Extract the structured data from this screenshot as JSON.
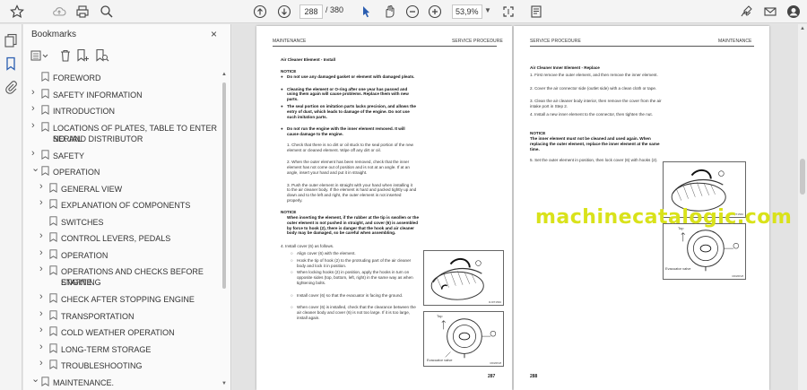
{
  "toolbar": {
    "page_current": "288",
    "page_total": "/ 380",
    "zoom": "53,9%",
    "icons": [
      "star-icon",
      "cloud-upload-icon",
      "print-icon",
      "search-icon",
      "prev-page-icon",
      "next-page-icon",
      "select-cursor-icon",
      "hand-tool-icon",
      "zoom-out-icon",
      "zoom-in-icon",
      "fit-page-icon",
      "page-display-icon",
      "sign-icon",
      "email-icon",
      "account-icon"
    ]
  },
  "rail": {
    "icons": [
      "pages-icon",
      "bookmarks-icon",
      "attachments-icon"
    ]
  },
  "bookmarks_panel": {
    "title": "Bookmarks",
    "close": "×",
    "items": [
      {
        "label": "FOREWORD",
        "level": 0,
        "expand": "none"
      },
      {
        "label": "SAFETY INFORMATION",
        "level": 0,
        "expand": "collapsed"
      },
      {
        "label": "INTRODUCTION",
        "level": 0,
        "expand": "collapsed"
      },
      {
        "label": "LOCATIONS OF PLATES, TABLE TO ENTER SERIAL",
        "label2": "NO. AND DISTRIBUTOR",
        "level": 0,
        "expand": "collapsed"
      },
      {
        "label": "SAFETY",
        "level": 0,
        "expand": "collapsed"
      },
      {
        "label": "OPERATION",
        "level": 0,
        "expand": "expanded"
      },
      {
        "label": "GENERAL VIEW",
        "level": 1,
        "expand": "collapsed"
      },
      {
        "label": "EXPLANATION OF COMPONENTS",
        "level": 1,
        "expand": "collapsed"
      },
      {
        "label": "SWITCHES",
        "level": 1,
        "expand": "none"
      },
      {
        "label": "CONTROL LEVERS, PEDALS",
        "level": 1,
        "expand": "collapsed"
      },
      {
        "label": "OPERATION",
        "level": 1,
        "expand": "collapsed"
      },
      {
        "label": "OPERATIONS AND CHECKS BEFORE STARTING",
        "label2": "ENGINE",
        "level": 1,
        "expand": "collapsed"
      },
      {
        "label": "CHECK AFTER STOPPING ENGINE",
        "level": 1,
        "expand": "collapsed"
      },
      {
        "label": "TRANSPORTATION",
        "level": 1,
        "expand": "collapsed"
      },
      {
        "label": "COLD WEATHER OPERATION",
        "level": 1,
        "expand": "collapsed"
      },
      {
        "label": "LONG-TERM STORAGE",
        "level": 1,
        "expand": "collapsed"
      },
      {
        "label": "TROUBLESHOOTING",
        "level": 1,
        "expand": "collapsed"
      },
      {
        "label": "MAINTENANCE.",
        "level": 0,
        "expand": "expanded"
      }
    ]
  },
  "document": {
    "left_page": {
      "header_left": "MAINTENANCE",
      "header_right": "SERVICE PROCEDURE",
      "section_title": "Air Cleaner Element - Install",
      "notice": "NOTICE",
      "bullets": [
        "Do not use any damaged gasket or element with damaged pleats.",
        "Cleaning the element or O-ring after one year has passed and using them again will cause problems. Replace them with new parts.",
        "The seal portion on imitation parts lacks precision, and allows the entry of dust, which leads to damage of the engine. Do not use such imitation parts.",
        "Do not run the engine with the inner element removed. It will cause damage to the engine."
      ],
      "steps": [
        "1. Check that there is no dirt or oil stuck to the seal portion of the new element or cleaned element. Wipe off any dirt or oil.",
        "2. When the outer element has been removed, check that the inner element has not come out of position and is not at an angle. If at an angle, insert your hand and put it in straight.",
        "3. Push the outer element in straight with your hand when installing it to the air cleaner body. If the element is hard and packed tightly up and down and to the left and right, the outer element is not inserted properly."
      ],
      "notice2": "NOTICE",
      "notice2_text": "When inserting the element, if the rubber at the tip is swollen or the outer element is not pushed in straight, and cover (6) is assembled by force to hook (2), there is danger that the hook and air cleaner body may be damaged, so be careful when assembling.",
      "step4": "4. Install cover (6) as follows.",
      "step4_items": [
        "Align cover (6) with the element.",
        "Hook the tip of hook (2) to the protruding part of the air cleaner body and lock it in position.",
        "When locking hooks (2) in position, apply the hooks in turn on opposite sides (top, bottom, left, right) in the same way as when tightening bolts.",
        "Install cover (6) so that the evacuator is facing the ground.",
        "When cover (6) is installed, check that the clearance between the air cleaner body and cover (6) is not too large. If it is too large, install again."
      ],
      "fig1_caption": "RJ0T1560",
      "fig2_top": "Top",
      "fig2_callout": "Evacuator valve",
      "fig2_caption": "RDW0V8",
      "page_number": "287"
    },
    "right_page": {
      "header_left": "SERVICE PROCEDURE",
      "header_right": "MAINTENANCE",
      "section_title": "Air Cleaner Inner Element - Replace",
      "steps": [
        "1. First remove the outer element, and then remove the inner element.",
        "2. Cover the air connector side (outlet side) with a clean cloth or tape.",
        "3. Clean the air cleaner body interior, then remove the cover from the air intake port in Step 2.",
        "4. Install a new inner element to the connector, then tighten the nut."
      ],
      "notice": "NOTICE",
      "notice_text": "The inner element must not be cleaned and used again. When replacing the outer element, replace the inner element at the same time.",
      "step5": "5. Set the outer element in position, then lock cover (6) with hooks (2).",
      "fig1_caption": "RJ0T1560",
      "fig2_top": "Top",
      "fig2_callout": "Evacuator valve",
      "fig2_caption": "RDW0V8",
      "page_number": "288"
    },
    "watermark": "machinecatalogic.com"
  }
}
